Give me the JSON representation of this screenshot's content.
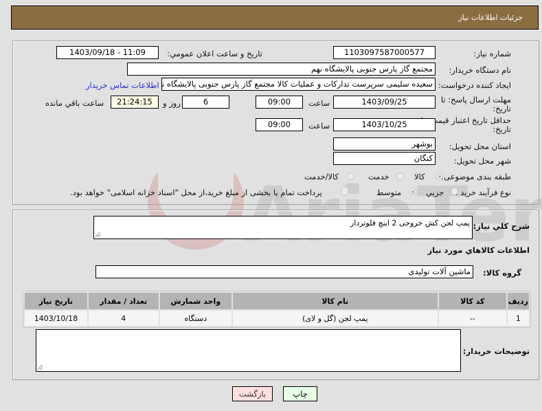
{
  "header": {
    "title": "جزئیات اطلاعات نیاز"
  },
  "form": {
    "need_number": {
      "label": "شماره نیاز:",
      "value": "1103097587000577"
    },
    "announce_datetime": {
      "label": "تاريخ و ساعت اعلان عمومي:",
      "value": "1403/09/18 - 11:09"
    },
    "buyer_org": {
      "label": "نام دستگاه خریدار:",
      "value": "مجتمع گاز پارس جنوبی  پالایشگاه نهم"
    },
    "requester": {
      "label": "ایجاد کننده درخواست:",
      "value": "سعیده سلیمی سرپرست تدارکات و عملیات کالا مجتمع گاز پارس جنوبی  پالایشگاه نهم",
      "contact_link": "اطلاعات تماس خریدار"
    },
    "response_deadline": {
      "label_line1": "مهلت ارسال پاسخ: تا",
      "label_line2": "تاریخ:",
      "date": "1403/09/25",
      "time_label": "ساعت",
      "time": "09:00",
      "days": "6",
      "days_label": "روز و",
      "remaining": "21:24:15",
      "remaining_label": "ساعت باقي مانده"
    },
    "price_validity": {
      "label_line1": "حداقل تاریخ اعتبار قیمت: تا",
      "label_line2": "تاریخ:",
      "date": "1403/10/25",
      "time_label": "ساعت",
      "time": "09:00"
    },
    "province": {
      "label": "استان محل تحویل:",
      "value": "بوشهر"
    },
    "city": {
      "label": "شهر محل تحویل:",
      "value": "کنگان"
    },
    "category": {
      "label": "طبقه بندی موضوعی:",
      "options": [
        "کالا",
        "خدمت",
        "کالا/خدمت"
      ],
      "selected": "کالا"
    },
    "purchase_type": {
      "label": "نوع فرآیند خرید :",
      "options": [
        "جزيي",
        "متوسط"
      ],
      "selected": "متوسط",
      "treasury_checkbox_label": "پرداخت تمام یا بخشی از مبلغ خرید،از محل \"اسناد خزانه اسلامی\" خواهد بود.",
      "treasury_checked": false
    }
  },
  "details": {
    "description_label": "شرح كلي نياز:",
    "description_value": "پمپ لجن کش خروجی 2 اینچ فلوتردار",
    "items_heading": "اطلاعات كالاهاي مورد نياز",
    "goods_group_label": "گروه کالا:",
    "goods_group_value": "ماشین آلات تولیدی",
    "table": {
      "headers": [
        "ردیف",
        "کد کالا",
        "نام کالا",
        "واحد شمارش",
        "تعداد / مقدار",
        "تاریخ نیاز"
      ],
      "rows": [
        [
          "1",
          "--",
          "پمپ لجن (گل و لای)",
          "دستگاه",
          "4",
          "1403/10/18"
        ]
      ]
    },
    "buyer_notes_label": "توضیحات خریدار:",
    "buyer_notes_value": ""
  },
  "buttons": {
    "print": "چاپ",
    "back": "بازگشت"
  },
  "colors": {
    "header_bg": "#8c6d42",
    "print_bg": "#e6ffe6",
    "back_bg": "#ffe0e0",
    "link": "#2b2bd6"
  },
  "watermark": {
    "text": "AriaTender.neT"
  }
}
